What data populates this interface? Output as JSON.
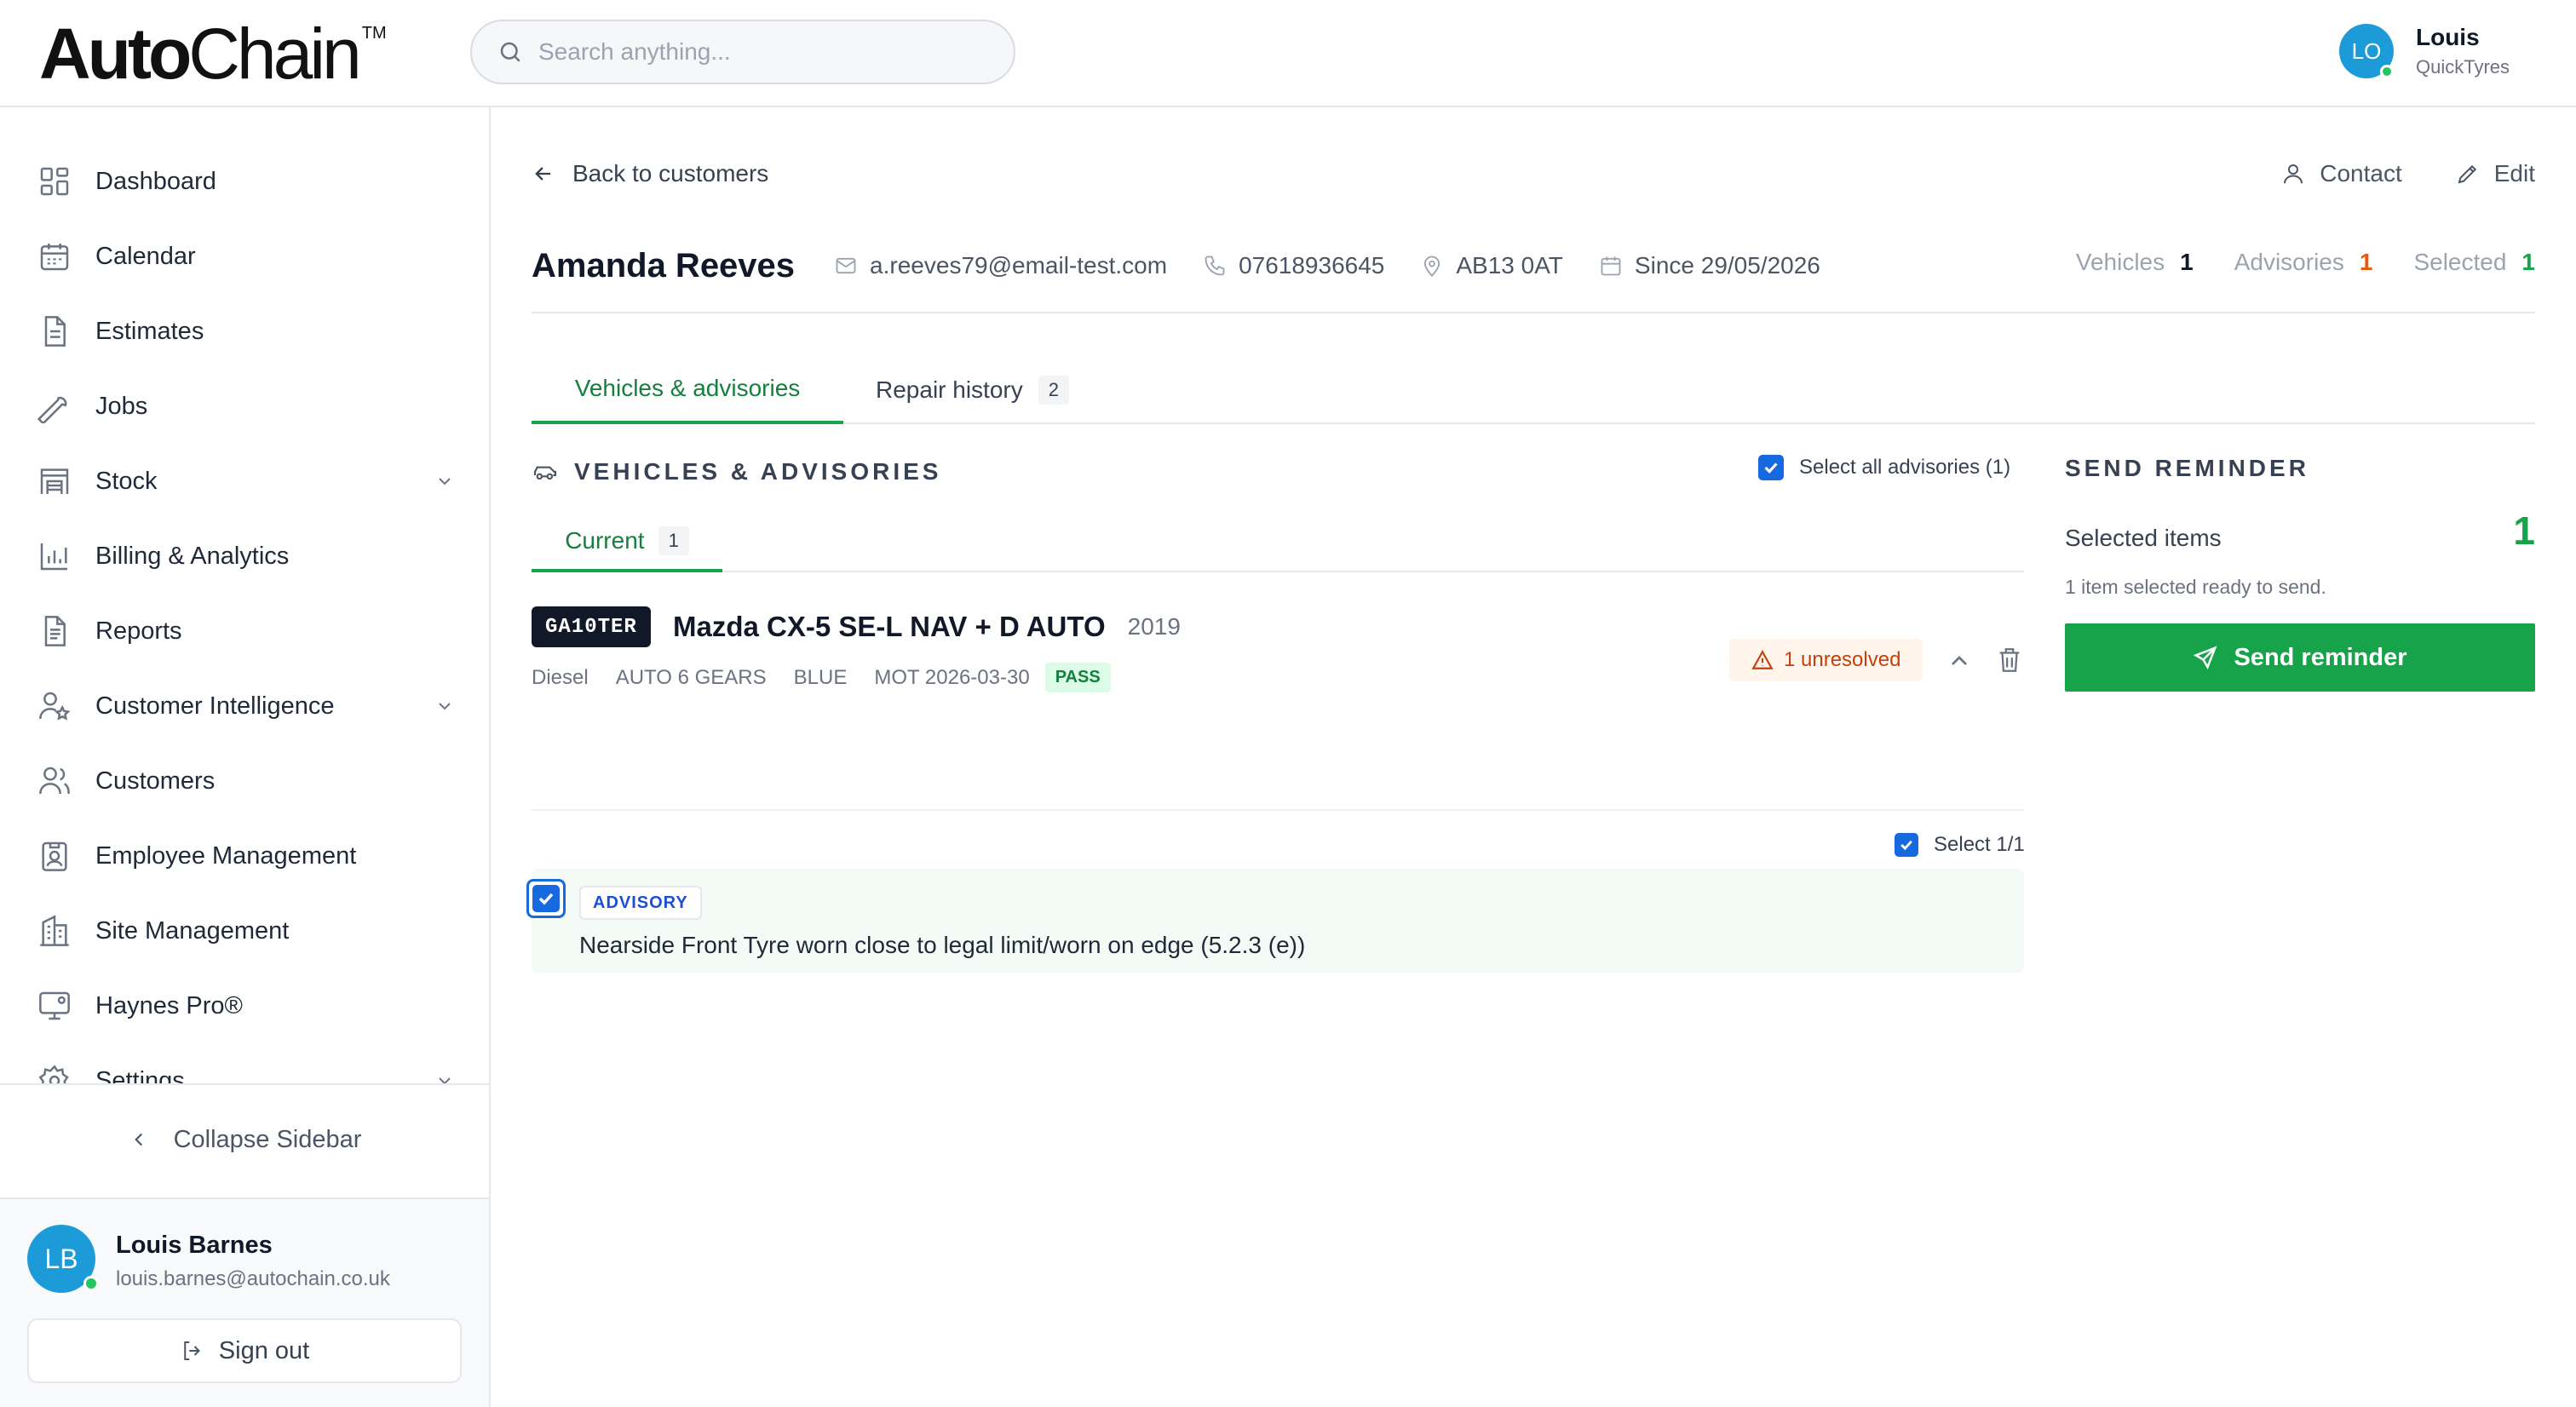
{
  "brand": {
    "name_bold": "Auto",
    "name_light": "Chain",
    "tm": "TM"
  },
  "search": {
    "placeholder": "Search anything..."
  },
  "top_user": {
    "initials": "LO",
    "name": "Louis",
    "company": "QuickTyres"
  },
  "sidebar": {
    "items": [
      {
        "label": "Dashboard",
        "icon": "dashboard-icon"
      },
      {
        "label": "Calendar",
        "icon": "calendar-icon"
      },
      {
        "label": "Estimates",
        "icon": "document-icon"
      },
      {
        "label": "Jobs",
        "icon": "wrench-icon"
      },
      {
        "label": "Stock",
        "icon": "warehouse-icon",
        "expandable": true
      },
      {
        "label": "Billing & Analytics",
        "icon": "bar-chart-icon"
      },
      {
        "label": "Reports",
        "icon": "report-icon"
      },
      {
        "label": "Customer Intelligence",
        "icon": "user-star-icon",
        "expandable": true
      },
      {
        "label": "Customers",
        "icon": "users-icon"
      },
      {
        "label": "Employee Management",
        "icon": "id-badge-icon"
      },
      {
        "label": "Site Management",
        "icon": "building-icon"
      },
      {
        "label": "Haynes Pro®",
        "icon": "monitor-icon"
      },
      {
        "label": "Settings",
        "icon": "gear-icon",
        "expandable": true
      }
    ],
    "collapse_label": "Collapse Sidebar",
    "user": {
      "initials": "LB",
      "name": "Louis Barnes",
      "email": "louis.barnes@autochain.co.uk"
    },
    "sign_out": "Sign out"
  },
  "header": {
    "back_label": "Back to customers",
    "contact_label": "Contact",
    "edit_label": "Edit"
  },
  "customer": {
    "name": "Amanda Reeves",
    "email": "a.reeves79@email-test.com",
    "phone": "07618936645",
    "postcode": "AB13 0AT",
    "since": "Since 29/05/2026",
    "stats": {
      "vehicles_label": "Vehicles",
      "vehicles": "1",
      "advisories_label": "Advisories",
      "advisories": "1",
      "selected_label": "Selected",
      "selected": "1"
    }
  },
  "tabs": [
    {
      "label": "Vehicles & advisories",
      "active": true
    },
    {
      "label": "Repair history",
      "badge": "2"
    }
  ],
  "vehicles_section": {
    "title": "VEHICLES & ADVISORIES",
    "select_all": "Select all advisories (1)",
    "subtab": {
      "label": "Current",
      "badge": "1"
    },
    "vehicle": {
      "plate": "GA10TER",
      "model": "Mazda CX-5 SE-L NAV + D AUTO",
      "year": "2019",
      "fuel": "Diesel",
      "gearbox": "AUTO 6 GEARS",
      "colour": "BLUE",
      "mot": "MOT 2026-03-30",
      "mot_status": "PASS",
      "unresolved": "1 unresolved"
    },
    "select_count": "Select 1/1",
    "advisory": {
      "badge": "ADVISORY",
      "text": "Nearside Front Tyre worn close to legal limit/worn on edge (5.2.3 (e))"
    }
  },
  "reminder": {
    "title": "SEND REMINDER",
    "selected_label": "Selected items",
    "selected_count": "1",
    "ready_text": "1 item selected ready to send.",
    "button": "Send reminder"
  },
  "colors": {
    "accent_green": "#16a34a",
    "advisory_orange": "#ea580c",
    "checkbox_blue": "#1769e0",
    "plate_dark": "#111827"
  }
}
